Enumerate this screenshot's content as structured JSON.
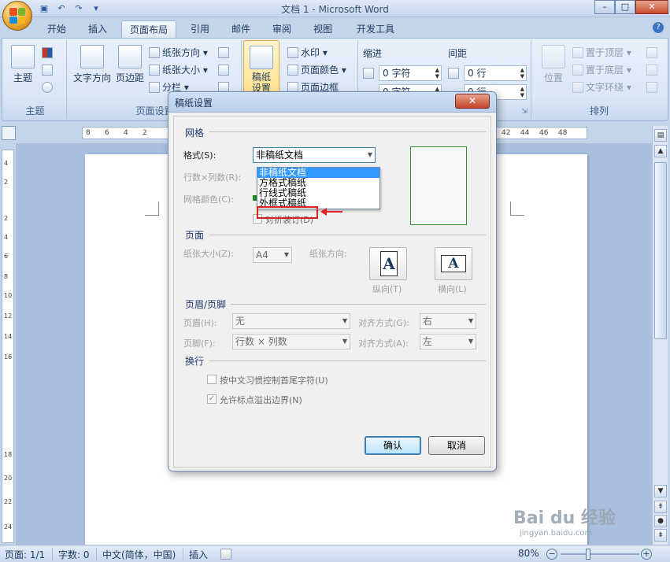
{
  "window": {
    "title": "文档 1 - Microsoft Word"
  },
  "ribbon": {
    "tabs": [
      "开始",
      "插入",
      "页面布局",
      "引用",
      "邮件",
      "审阅",
      "视图",
      "开发工具"
    ],
    "active_tab": "页面布局",
    "groups": {
      "theme": {
        "label": "主题",
        "button": "主题"
      },
      "page_setup": {
        "label": "页面设置",
        "text_direction": "文字方向",
        "margins": "页边距",
        "orientation": "纸张方向",
        "size": "纸张大小",
        "columns": "分栏"
      },
      "manuscript": {
        "label": "稿纸",
        "button": "稿纸设置"
      },
      "page_background": {
        "watermark": "水印",
        "page_color": "页面颜色",
        "page_borders": "页面边框"
      },
      "paragraph": {
        "indent_label": "缩进",
        "spacing_label": "间距",
        "indent_left": "0 字符",
        "indent_right": "0 字符",
        "spacing_before": "0 行",
        "spacing_after": "0 行"
      },
      "arrange": {
        "label": "排列",
        "position": "位置",
        "bring_front": "置于顶层",
        "send_back": "置于底层",
        "text_wrap": "文字环绕"
      }
    }
  },
  "ruler": {
    "numbers_left": [
      "8",
      "6",
      "4",
      "2"
    ],
    "numbers_right": [
      "42",
      "44",
      "46",
      "48"
    ],
    "vertical": [
      "4",
      "2",
      "2",
      "4",
      "6",
      "8",
      "10",
      "12",
      "14",
      "16",
      "18",
      "20",
      "22",
      "24"
    ]
  },
  "dialog": {
    "title": "稿纸设置",
    "close": "✕",
    "grid": {
      "section": "网格",
      "format_label": "格式(S):",
      "format_value": "非稿纸文档",
      "rows_cols_label": "行数×列数(R):",
      "grid_color_label": "网格颜色(C):",
      "fold_label": "对折装订(D)",
      "dropdown_options": [
        "非稿纸文档",
        "方格式稿纸",
        "行线式稿纸",
        "外框式稿纸"
      ],
      "selected_option": "非稿纸文档",
      "highlighted_option": "行线式稿纸"
    },
    "page": {
      "section": "页面",
      "paper_size_label": "纸张大小(Z):",
      "paper_size_value": "A4",
      "orientation_label": "纸张方向:",
      "portrait": "纵向(T)",
      "landscape": "横向(L)",
      "letter": "A"
    },
    "header_footer": {
      "section": "页眉/页脚",
      "header_label": "页眉(H):",
      "header_value": "无",
      "footer_label": "页脚(F):",
      "footer_value": "行数 × 列数",
      "align_g_label": "对齐方式(G):",
      "align_g_value": "右",
      "align_a_label": "对齐方式(A):",
      "align_a_value": "左"
    },
    "wrap": {
      "section": "换行",
      "opt1": "按中文习惯控制首尾字符(U)",
      "opt2": "允许标点溢出边界(N)"
    },
    "ok": "确认",
    "cancel": "取消"
  },
  "statusbar": {
    "page": "页面: 1/1",
    "words": "字数: 0",
    "language": "中文(简体，中国)",
    "insert": "插入",
    "zoom": "80%"
  },
  "watermark": {
    "main": "Bai du 经验",
    "sub": "jingyan.baidu.com"
  },
  "colors": {
    "accent": "#3399ff",
    "annotation": "#e02020",
    "preview_border": "#2f8f2f"
  }
}
